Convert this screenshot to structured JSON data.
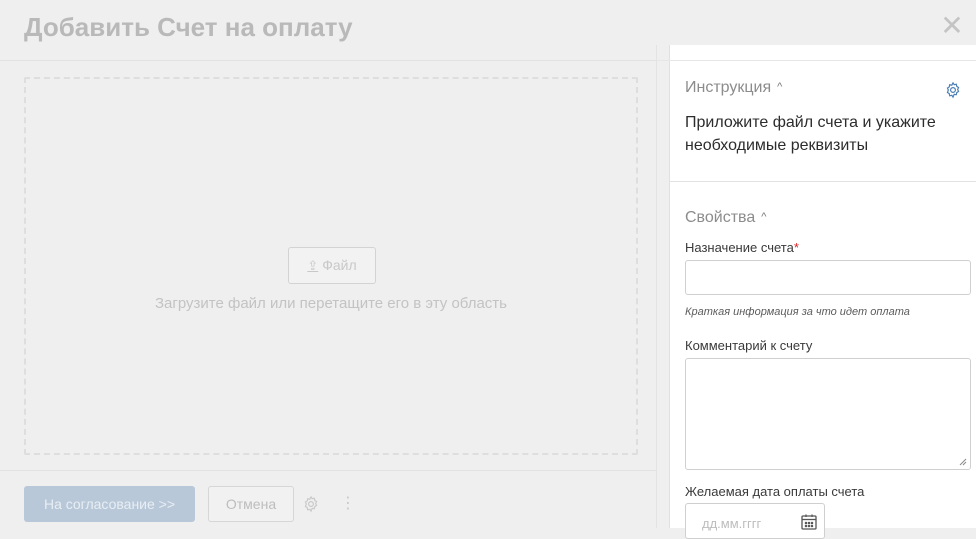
{
  "modal": {
    "title": "Добавить Счет на оплату",
    "close_glyph": "✕"
  },
  "upload": {
    "file_button_icon": "⇪",
    "file_button_label": "Файл",
    "hint": "Загрузите файл или перетащите его в эту область"
  },
  "footer": {
    "submit_label": "На согласование >>",
    "cancel_label": "Отмена",
    "more_glyph": "⋮"
  },
  "panel": {
    "instruction": {
      "title": "Инструкция",
      "caret": "^",
      "text": "Приложите файл счета и укажите необходимые реквизиты"
    },
    "properties": {
      "title": "Свойства",
      "caret": "^",
      "purpose_label": "Назначение счета",
      "required_mark": "*",
      "purpose_value": "",
      "purpose_help": "Краткая информация за что идет оплата",
      "comment_label": "Комментарий к счету",
      "comment_value": "",
      "date_label": "Желаемая дата оплаты счета",
      "date_placeholder": "дд.мм.гггг"
    }
  },
  "colors": {
    "primary_button": "#b9c8d8",
    "required": "#dd2222",
    "background": "#efefef",
    "panel": "#ffffff"
  },
  "icons": [
    "close-icon",
    "upload-icon",
    "gear-icon",
    "more-dots-icon",
    "chevron-up-icon",
    "calendar-icon"
  ]
}
